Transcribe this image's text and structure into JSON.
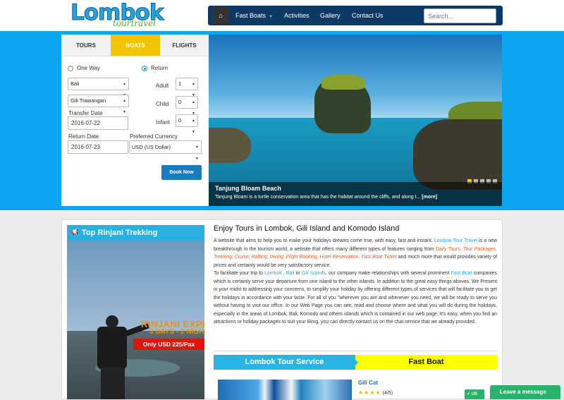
{
  "header": {
    "logo_main": "Lombok",
    "logo_sub": "tourtravel",
    "nav": {
      "home_icon": "home-icon",
      "items": [
        "Fast Boats",
        "Activities",
        "Gallery",
        "Contact Us"
      ]
    },
    "search_placeholder": "Search..."
  },
  "booking": {
    "tabs": [
      "TOURS",
      "BOATS",
      "FLIGHTS"
    ],
    "active_tab": "BOATS",
    "trip_options": [
      "One Way",
      "Return"
    ],
    "selected_trip": "Return",
    "from": "Bali",
    "to": "Gili Trawangan",
    "adult_label": "Adult",
    "adult_value": "1",
    "child_label": "Child",
    "child_value": "0",
    "infant_label": "Infant",
    "infant_value": "0",
    "transfer_date_label": "Transfer Date",
    "transfer_date": "2016-07-22",
    "return_date_label": "Return Date",
    "return_date": "2016-07-23",
    "currency_label": "Preferred Currency",
    "currency": "USD (US Dollar)",
    "submit": "Book Now"
  },
  "slider": {
    "title": "Tanjung Bloam Beach",
    "text": "Tanjung Bloam is a turtle conservation area that has the habitat around the cliffs, and along t...",
    "more": "[more]",
    "total_slides": 5,
    "active_slide": 1
  },
  "promo": {
    "heading": "Top Rinjani Trekking",
    "title": "RINJANI EXPEDITION",
    "days": "3 DAYS - 2 NIGHTS",
    "price": "Only USD 225/Pax"
  },
  "about": {
    "title": "Enjoy Tours in Lombok, Gili Island and Komodo Island",
    "p1_a": "A website that aims to help you to make your holidays dreams come true, with easy, fast and instant. ",
    "p1_brand": "Lombok Tour Travel",
    "p1_b": " is a new breakthrough in the tourism world, a website that offers many different types of features ranging from ",
    "p1_features": "Daily Tours, Tour Packages, Trekking, Cruise, Rafting, Diving, Flight Booking, Hotel Reservation, Fast Boat Ticket",
    "p1_c": " and much more that would provides variety of prices and certainly would be very satisfactory service.",
    "p2_a": "To facilitate your trip to ",
    "p2_lombok": "Lombok",
    "p2_b": " , ",
    "p2_bali": "Bali",
    "p2_c": " or ",
    "p2_gili": "Gili Islands",
    "p2_d": ", our company make relationships with several prominent ",
    "p2_fastboat": "Fast Boat",
    "p2_e": " companies which is certainly serve your departure from one island to the other islands. In addition to the great easy things aboves, We Present in your midst to addressing your concerns, to simplify your holiday by offering different types of services that will facilitate you to get the holidays in accordance with your taste. For all of you \"wherever you are and whenever you need, we will be ready to serve you without having to visit our office. In our Web Page you can see, read and choose where and what you will do during the holidays, especially in the areas of Lombok, Bali, Komodo and others islands which is contained in our web page. It's easy, when you find an attractions or holiday packages to suit your liking, you can directly contact us on the chat service that we already provided."
  },
  "services": {
    "tab_left": "Lombok Tour Service",
    "tab_right": "Fast Boat",
    "item_name": "Gili Cat",
    "rating_stars": 4,
    "rating_text": "(4/5)"
  },
  "chat": {
    "badge": "US",
    "label": "Leave a message"
  },
  "colors": {
    "nav_bg": "#0c3a66",
    "band": "#0ea5f0",
    "active_tab": "#f5c400",
    "button": "#1a7bbf",
    "accent": "#29b5e3",
    "chat": "#28b26a"
  }
}
